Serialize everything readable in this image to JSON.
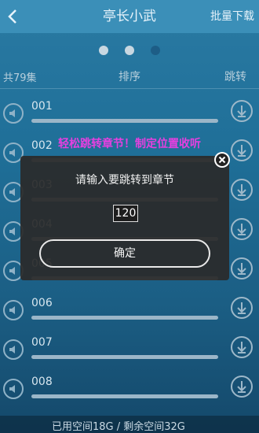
{
  "topbar": {
    "title": "亭长小武",
    "batch_download": "批量下载"
  },
  "carousel": {
    "count": 3,
    "active_index": 2
  },
  "list_header": {
    "count": "共79集",
    "sort": "排序",
    "jump": "跳转"
  },
  "rows": [
    {
      "num": "001"
    },
    {
      "num": "002"
    },
    {
      "num": "003"
    },
    {
      "num": "004"
    },
    {
      "num": "005"
    },
    {
      "num": "006"
    },
    {
      "num": "007"
    },
    {
      "num": "008"
    }
  ],
  "promo": "轻松跳转章节！制定位置收听",
  "dialog": {
    "prompt": "请输入要跳转到章节",
    "input_value": "120",
    "confirm": "确定"
  },
  "footer": {
    "storage": "已用空间18G / 剩余空间32G"
  },
  "colors": {
    "promo": "#e73fe0",
    "topbar": "#3b8fb8",
    "active_dot": "#1d5d86"
  },
  "icons": [
    "back-icon",
    "speaker-icon",
    "download-icon",
    "close-icon"
  ]
}
